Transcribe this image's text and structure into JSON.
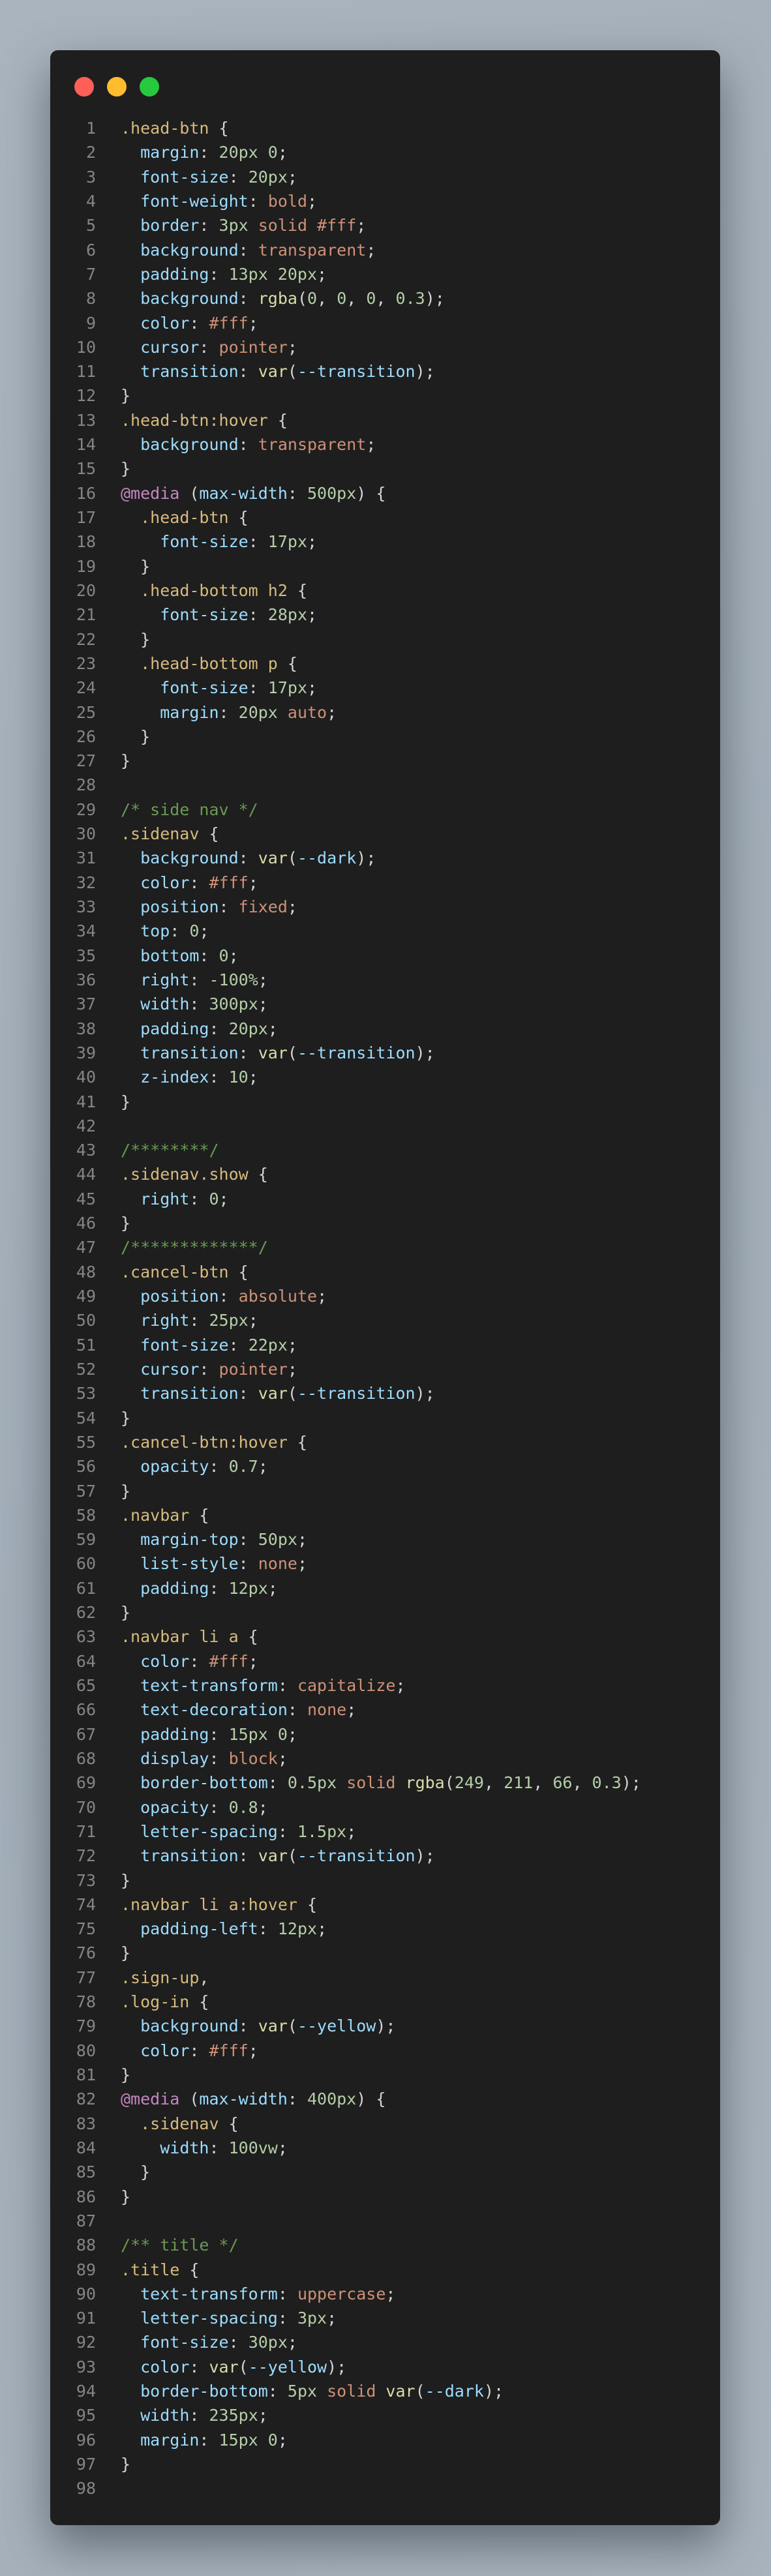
{
  "window": {
    "controls": {
      "close": "#ff5f56",
      "minimize": "#ffbd2e",
      "maximize": "#27c93f"
    }
  },
  "lines": [
    [
      [
        "s",
        ".head-btn"
      ],
      [
        "u",
        " {"
      ]
    ],
    [
      [
        "u",
        "  "
      ],
      [
        "p",
        "margin"
      ],
      [
        "u",
        ": "
      ],
      [
        "n",
        "20px 0"
      ],
      [
        "u",
        ";"
      ]
    ],
    [
      [
        "u",
        "  "
      ],
      [
        "p",
        "font-size"
      ],
      [
        "u",
        ": "
      ],
      [
        "n",
        "20px"
      ],
      [
        "u",
        ";"
      ]
    ],
    [
      [
        "u",
        "  "
      ],
      [
        "p",
        "font-weight"
      ],
      [
        "u",
        ": "
      ],
      [
        "k",
        "bold"
      ],
      [
        "u",
        ";"
      ]
    ],
    [
      [
        "u",
        "  "
      ],
      [
        "p",
        "border"
      ],
      [
        "u",
        ": "
      ],
      [
        "n",
        "3px "
      ],
      [
        "k",
        "solid #fff"
      ],
      [
        "u",
        ";"
      ]
    ],
    [
      [
        "u",
        "  "
      ],
      [
        "p",
        "background"
      ],
      [
        "u",
        ": "
      ],
      [
        "k",
        "transparent"
      ],
      [
        "u",
        ";"
      ]
    ],
    [
      [
        "u",
        "  "
      ],
      [
        "p",
        "padding"
      ],
      [
        "u",
        ": "
      ],
      [
        "n",
        "13px 20px"
      ],
      [
        "u",
        ";"
      ]
    ],
    [
      [
        "u",
        "  "
      ],
      [
        "p",
        "background"
      ],
      [
        "u",
        ": "
      ],
      [
        "f",
        "rgba"
      ],
      [
        "u",
        "("
      ],
      [
        "n",
        "0"
      ],
      [
        "u",
        ", "
      ],
      [
        "n",
        "0"
      ],
      [
        "u",
        ", "
      ],
      [
        "n",
        "0"
      ],
      [
        "u",
        ", "
      ],
      [
        "n",
        "0.3"
      ],
      [
        "u",
        ");"
      ]
    ],
    [
      [
        "u",
        "  "
      ],
      [
        "p",
        "color"
      ],
      [
        "u",
        ": "
      ],
      [
        "k",
        "#fff"
      ],
      [
        "u",
        ";"
      ]
    ],
    [
      [
        "u",
        "  "
      ],
      [
        "p",
        "cursor"
      ],
      [
        "u",
        ": "
      ],
      [
        "k",
        "pointer"
      ],
      [
        "u",
        ";"
      ]
    ],
    [
      [
        "u",
        "  "
      ],
      [
        "p",
        "transition"
      ],
      [
        "u",
        ": "
      ],
      [
        "f",
        "var"
      ],
      [
        "u",
        "("
      ],
      [
        "p",
        "--transition"
      ],
      [
        "u",
        ");"
      ]
    ],
    [
      [
        "u",
        "}"
      ]
    ],
    [
      [
        "s",
        ".head-btn:hover"
      ],
      [
        "u",
        " {"
      ]
    ],
    [
      [
        "u",
        "  "
      ],
      [
        "p",
        "background"
      ],
      [
        "u",
        ": "
      ],
      [
        "k",
        "transparent"
      ],
      [
        "u",
        ";"
      ]
    ],
    [
      [
        "u",
        "}"
      ]
    ],
    [
      [
        "a",
        "@media"
      ],
      [
        "u",
        " ("
      ],
      [
        "p",
        "max-width"
      ],
      [
        "u",
        ": "
      ],
      [
        "n",
        "500px"
      ],
      [
        "u",
        ") {"
      ]
    ],
    [
      [
        "u",
        "  "
      ],
      [
        "s",
        ".head-btn"
      ],
      [
        "u",
        " {"
      ]
    ],
    [
      [
        "u",
        "    "
      ],
      [
        "p",
        "font-size"
      ],
      [
        "u",
        ": "
      ],
      [
        "n",
        "17px"
      ],
      [
        "u",
        ";"
      ]
    ],
    [
      [
        "u",
        "  }"
      ]
    ],
    [
      [
        "u",
        "  "
      ],
      [
        "s",
        ".head-bottom h2"
      ],
      [
        "u",
        " {"
      ]
    ],
    [
      [
        "u",
        "    "
      ],
      [
        "p",
        "font-size"
      ],
      [
        "u",
        ": "
      ],
      [
        "n",
        "28px"
      ],
      [
        "u",
        ";"
      ]
    ],
    [
      [
        "u",
        "  }"
      ]
    ],
    [
      [
        "u",
        "  "
      ],
      [
        "s",
        ".head-bottom p"
      ],
      [
        "u",
        " {"
      ]
    ],
    [
      [
        "u",
        "    "
      ],
      [
        "p",
        "font-size"
      ],
      [
        "u",
        ": "
      ],
      [
        "n",
        "17px"
      ],
      [
        "u",
        ";"
      ]
    ],
    [
      [
        "u",
        "    "
      ],
      [
        "p",
        "margin"
      ],
      [
        "u",
        ": "
      ],
      [
        "n",
        "20px "
      ],
      [
        "k",
        "auto"
      ],
      [
        "u",
        ";"
      ]
    ],
    [
      [
        "u",
        "  }"
      ]
    ],
    [
      [
        "u",
        "}"
      ]
    ],
    [],
    [
      [
        "c",
        "/* side nav */"
      ]
    ],
    [
      [
        "s",
        ".sidenav"
      ],
      [
        "u",
        " {"
      ]
    ],
    [
      [
        "u",
        "  "
      ],
      [
        "p",
        "background"
      ],
      [
        "u",
        ": "
      ],
      [
        "f",
        "var"
      ],
      [
        "u",
        "("
      ],
      [
        "p",
        "--dark"
      ],
      [
        "u",
        ");"
      ]
    ],
    [
      [
        "u",
        "  "
      ],
      [
        "p",
        "color"
      ],
      [
        "u",
        ": "
      ],
      [
        "k",
        "#fff"
      ],
      [
        "u",
        ";"
      ]
    ],
    [
      [
        "u",
        "  "
      ],
      [
        "p",
        "position"
      ],
      [
        "u",
        ": "
      ],
      [
        "k",
        "fixed"
      ],
      [
        "u",
        ";"
      ]
    ],
    [
      [
        "u",
        "  "
      ],
      [
        "p",
        "top"
      ],
      [
        "u",
        ": "
      ],
      [
        "n",
        "0"
      ],
      [
        "u",
        ";"
      ]
    ],
    [
      [
        "u",
        "  "
      ],
      [
        "p",
        "bottom"
      ],
      [
        "u",
        ": "
      ],
      [
        "n",
        "0"
      ],
      [
        "u",
        ";"
      ]
    ],
    [
      [
        "u",
        "  "
      ],
      [
        "p",
        "right"
      ],
      [
        "u",
        ": "
      ],
      [
        "n",
        "-100%"
      ],
      [
        "u",
        ";"
      ]
    ],
    [
      [
        "u",
        "  "
      ],
      [
        "p",
        "width"
      ],
      [
        "u",
        ": "
      ],
      [
        "n",
        "300px"
      ],
      [
        "u",
        ";"
      ]
    ],
    [
      [
        "u",
        "  "
      ],
      [
        "p",
        "padding"
      ],
      [
        "u",
        ": "
      ],
      [
        "n",
        "20px"
      ],
      [
        "u",
        ";"
      ]
    ],
    [
      [
        "u",
        "  "
      ],
      [
        "p",
        "transition"
      ],
      [
        "u",
        ": "
      ],
      [
        "f",
        "var"
      ],
      [
        "u",
        "("
      ],
      [
        "p",
        "--transition"
      ],
      [
        "u",
        ");"
      ]
    ],
    [
      [
        "u",
        "  "
      ],
      [
        "p",
        "z-index"
      ],
      [
        "u",
        ": "
      ],
      [
        "n",
        "10"
      ],
      [
        "u",
        ";"
      ]
    ],
    [
      [
        "u",
        "}"
      ]
    ],
    [],
    [
      [
        "c",
        "/********/"
      ]
    ],
    [
      [
        "s",
        ".sidenav.show"
      ],
      [
        "u",
        " {"
      ]
    ],
    [
      [
        "u",
        "  "
      ],
      [
        "p",
        "right"
      ],
      [
        "u",
        ": "
      ],
      [
        "n",
        "0"
      ],
      [
        "u",
        ";"
      ]
    ],
    [
      [
        "u",
        "}"
      ]
    ],
    [
      [
        "c",
        "/*************/"
      ]
    ],
    [
      [
        "s",
        ".cancel-btn"
      ],
      [
        "u",
        " {"
      ]
    ],
    [
      [
        "u",
        "  "
      ],
      [
        "p",
        "position"
      ],
      [
        "u",
        ": "
      ],
      [
        "k",
        "absolute"
      ],
      [
        "u",
        ";"
      ]
    ],
    [
      [
        "u",
        "  "
      ],
      [
        "p",
        "right"
      ],
      [
        "u",
        ": "
      ],
      [
        "n",
        "25px"
      ],
      [
        "u",
        ";"
      ]
    ],
    [
      [
        "u",
        "  "
      ],
      [
        "p",
        "font-size"
      ],
      [
        "u",
        ": "
      ],
      [
        "n",
        "22px"
      ],
      [
        "u",
        ";"
      ]
    ],
    [
      [
        "u",
        "  "
      ],
      [
        "p",
        "cursor"
      ],
      [
        "u",
        ": "
      ],
      [
        "k",
        "pointer"
      ],
      [
        "u",
        ";"
      ]
    ],
    [
      [
        "u",
        "  "
      ],
      [
        "p",
        "transition"
      ],
      [
        "u",
        ": "
      ],
      [
        "f",
        "var"
      ],
      [
        "u",
        "("
      ],
      [
        "p",
        "--transition"
      ],
      [
        "u",
        ");"
      ]
    ],
    [
      [
        "u",
        "}"
      ]
    ],
    [
      [
        "s",
        ".cancel-btn:hover"
      ],
      [
        "u",
        " {"
      ]
    ],
    [
      [
        "u",
        "  "
      ],
      [
        "p",
        "opacity"
      ],
      [
        "u",
        ": "
      ],
      [
        "n",
        "0.7"
      ],
      [
        "u",
        ";"
      ]
    ],
    [
      [
        "u",
        "}"
      ]
    ],
    [
      [
        "s",
        ".navbar"
      ],
      [
        "u",
        " {"
      ]
    ],
    [
      [
        "u",
        "  "
      ],
      [
        "p",
        "margin-top"
      ],
      [
        "u",
        ": "
      ],
      [
        "n",
        "50px"
      ],
      [
        "u",
        ";"
      ]
    ],
    [
      [
        "u",
        "  "
      ],
      [
        "p",
        "list-style"
      ],
      [
        "u",
        ": "
      ],
      [
        "k",
        "none"
      ],
      [
        "u",
        ";"
      ]
    ],
    [
      [
        "u",
        "  "
      ],
      [
        "p",
        "padding"
      ],
      [
        "u",
        ": "
      ],
      [
        "n",
        "12px"
      ],
      [
        "u",
        ";"
      ]
    ],
    [
      [
        "u",
        "}"
      ]
    ],
    [
      [
        "s",
        ".navbar li a"
      ],
      [
        "u",
        " {"
      ]
    ],
    [
      [
        "u",
        "  "
      ],
      [
        "p",
        "color"
      ],
      [
        "u",
        ": "
      ],
      [
        "k",
        "#fff"
      ],
      [
        "u",
        ";"
      ]
    ],
    [
      [
        "u",
        "  "
      ],
      [
        "p",
        "text-transform"
      ],
      [
        "u",
        ": "
      ],
      [
        "k",
        "capitalize"
      ],
      [
        "u",
        ";"
      ]
    ],
    [
      [
        "u",
        "  "
      ],
      [
        "p",
        "text-decoration"
      ],
      [
        "u",
        ": "
      ],
      [
        "k",
        "none"
      ],
      [
        "u",
        ";"
      ]
    ],
    [
      [
        "u",
        "  "
      ],
      [
        "p",
        "padding"
      ],
      [
        "u",
        ": "
      ],
      [
        "n",
        "15px 0"
      ],
      [
        "u",
        ";"
      ]
    ],
    [
      [
        "u",
        "  "
      ],
      [
        "p",
        "display"
      ],
      [
        "u",
        ": "
      ],
      [
        "k",
        "block"
      ],
      [
        "u",
        ";"
      ]
    ],
    [
      [
        "u",
        "  "
      ],
      [
        "p",
        "border-bottom"
      ],
      [
        "u",
        ": "
      ],
      [
        "n",
        "0.5px "
      ],
      [
        "k",
        "solid "
      ],
      [
        "f",
        "rgba"
      ],
      [
        "u",
        "("
      ],
      [
        "n",
        "249"
      ],
      [
        "u",
        ", "
      ],
      [
        "n",
        "211"
      ],
      [
        "u",
        ", "
      ],
      [
        "n",
        "66"
      ],
      [
        "u",
        ", "
      ],
      [
        "n",
        "0.3"
      ],
      [
        "u",
        ");"
      ]
    ],
    [
      [
        "u",
        "  "
      ],
      [
        "p",
        "opacity"
      ],
      [
        "u",
        ": "
      ],
      [
        "n",
        "0.8"
      ],
      [
        "u",
        ";"
      ]
    ],
    [
      [
        "u",
        "  "
      ],
      [
        "p",
        "letter-spacing"
      ],
      [
        "u",
        ": "
      ],
      [
        "n",
        "1.5px"
      ],
      [
        "u",
        ";"
      ]
    ],
    [
      [
        "u",
        "  "
      ],
      [
        "p",
        "transition"
      ],
      [
        "u",
        ": "
      ],
      [
        "f",
        "var"
      ],
      [
        "u",
        "("
      ],
      [
        "p",
        "--transition"
      ],
      [
        "u",
        ");"
      ]
    ],
    [
      [
        "u",
        "}"
      ]
    ],
    [
      [
        "s",
        ".navbar li a:hover"
      ],
      [
        "u",
        " {"
      ]
    ],
    [
      [
        "u",
        "  "
      ],
      [
        "p",
        "padding-left"
      ],
      [
        "u",
        ": "
      ],
      [
        "n",
        "12px"
      ],
      [
        "u",
        ";"
      ]
    ],
    [
      [
        "u",
        "}"
      ]
    ],
    [
      [
        "s",
        ".sign-up"
      ],
      [
        "u",
        ","
      ]
    ],
    [
      [
        "s",
        ".log-in"
      ],
      [
        "u",
        " {"
      ]
    ],
    [
      [
        "u",
        "  "
      ],
      [
        "p",
        "background"
      ],
      [
        "u",
        ": "
      ],
      [
        "f",
        "var"
      ],
      [
        "u",
        "("
      ],
      [
        "p",
        "--yellow"
      ],
      [
        "u",
        ");"
      ]
    ],
    [
      [
        "u",
        "  "
      ],
      [
        "p",
        "color"
      ],
      [
        "u",
        ": "
      ],
      [
        "k",
        "#fff"
      ],
      [
        "u",
        ";"
      ]
    ],
    [
      [
        "u",
        "}"
      ]
    ],
    [
      [
        "a",
        "@media"
      ],
      [
        "u",
        " ("
      ],
      [
        "p",
        "max-width"
      ],
      [
        "u",
        ": "
      ],
      [
        "n",
        "400px"
      ],
      [
        "u",
        ") {"
      ]
    ],
    [
      [
        "u",
        "  "
      ],
      [
        "s",
        ".sidenav"
      ],
      [
        "u",
        " {"
      ]
    ],
    [
      [
        "u",
        "    "
      ],
      [
        "p",
        "width"
      ],
      [
        "u",
        ": "
      ],
      [
        "n",
        "100vw"
      ],
      [
        "u",
        ";"
      ]
    ],
    [
      [
        "u",
        "  }"
      ]
    ],
    [
      [
        "u",
        "}"
      ]
    ],
    [],
    [
      [
        "c",
        "/** title */"
      ]
    ],
    [
      [
        "s",
        ".title"
      ],
      [
        "u",
        " {"
      ]
    ],
    [
      [
        "u",
        "  "
      ],
      [
        "p",
        "text-transform"
      ],
      [
        "u",
        ": "
      ],
      [
        "k",
        "uppercase"
      ],
      [
        "u",
        ";"
      ]
    ],
    [
      [
        "u",
        "  "
      ],
      [
        "p",
        "letter-spacing"
      ],
      [
        "u",
        ": "
      ],
      [
        "n",
        "3px"
      ],
      [
        "u",
        ";"
      ]
    ],
    [
      [
        "u",
        "  "
      ],
      [
        "p",
        "font-size"
      ],
      [
        "u",
        ": "
      ],
      [
        "n",
        "30px"
      ],
      [
        "u",
        ";"
      ]
    ],
    [
      [
        "u",
        "  "
      ],
      [
        "p",
        "color"
      ],
      [
        "u",
        ": "
      ],
      [
        "f",
        "var"
      ],
      [
        "u",
        "("
      ],
      [
        "p",
        "--yellow"
      ],
      [
        "u",
        ");"
      ]
    ],
    [
      [
        "u",
        "  "
      ],
      [
        "p",
        "border-bottom"
      ],
      [
        "u",
        ": "
      ],
      [
        "n",
        "5px "
      ],
      [
        "k",
        "solid "
      ],
      [
        "f",
        "var"
      ],
      [
        "u",
        "("
      ],
      [
        "p",
        "--dark"
      ],
      [
        "u",
        ");"
      ]
    ],
    [
      [
        "u",
        "  "
      ],
      [
        "p",
        "width"
      ],
      [
        "u",
        ": "
      ],
      [
        "n",
        "235px"
      ],
      [
        "u",
        ";"
      ]
    ],
    [
      [
        "u",
        "  "
      ],
      [
        "p",
        "margin"
      ],
      [
        "u",
        ": "
      ],
      [
        "n",
        "15px 0"
      ],
      [
        "u",
        ";"
      ]
    ],
    [
      [
        "u",
        "}"
      ]
    ],
    []
  ]
}
